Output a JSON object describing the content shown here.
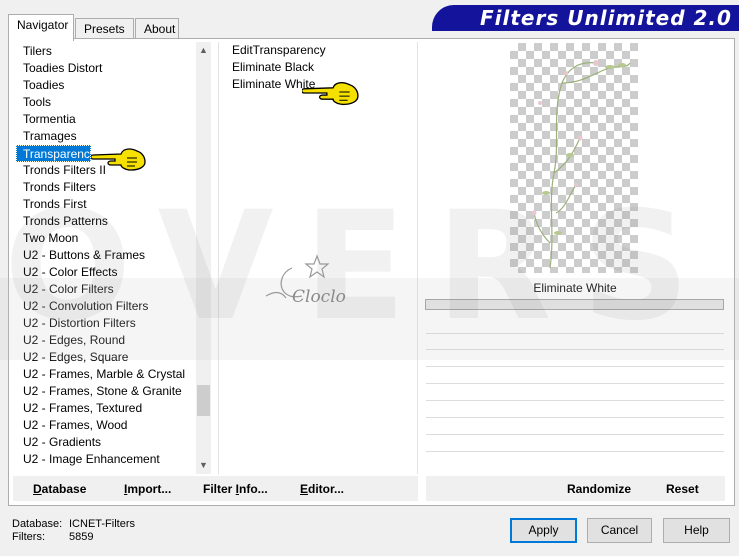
{
  "app": {
    "title": "Filters Unlimited 2.0"
  },
  "tabs": [
    {
      "label": "Navigator"
    },
    {
      "label": "Presets"
    },
    {
      "label": "About"
    }
  ],
  "categories": [
    "Tilers",
    "Toadies Distort",
    "Toadies",
    "Tools",
    "Tormentia",
    "Tramages",
    "Transparency",
    "Tronds Filters II",
    "Tronds Filters",
    "Tronds First",
    "Tronds Patterns",
    "Two Moon",
    "U2 - Buttons & Frames",
    "U2 - Color Effects",
    "U2 - Color Filters",
    "U2 - Convolution Filters",
    "U2 - Distortion Filters",
    "U2 - Edges, Round",
    "U2 - Edges, Square",
    "U2 - Frames, Marble & Crystal",
    "U2 - Frames, Stone & Granite",
    "U2 - Frames, Textured",
    "U2 - Frames, Wood",
    "U2 - Gradients",
    "U2 - Image Enhancement"
  ],
  "selected_category": "Transparency",
  "filters": [
    "EditTransparency",
    "Eliminate Black",
    "Eliminate White"
  ],
  "preview": {
    "filter_name": "Eliminate White"
  },
  "toolbar": {
    "database": {
      "underlined": "D",
      "rest": "atabase"
    },
    "import": {
      "underlined": "I",
      "rest": "mport..."
    },
    "filter_info": {
      "pre": "Filter ",
      "underlined": "I",
      "rest": "nfo..."
    },
    "editor": {
      "underlined": "E",
      "rest": "ditor..."
    },
    "randomize": "Randomize",
    "reset": "Reset"
  },
  "status": {
    "database_label": "Database:",
    "database_value": "ICNET-Filters",
    "filters_label": "Filters:",
    "filters_value": "5859"
  },
  "buttons": {
    "apply": "Apply",
    "cancel": "Cancel",
    "help": "Help"
  },
  "watermark": {
    "text": "OVERS",
    "signature": "Cloclo"
  },
  "colors": {
    "banner": "#13139c",
    "selection": "#0078d7",
    "hand": "#f5e000"
  }
}
